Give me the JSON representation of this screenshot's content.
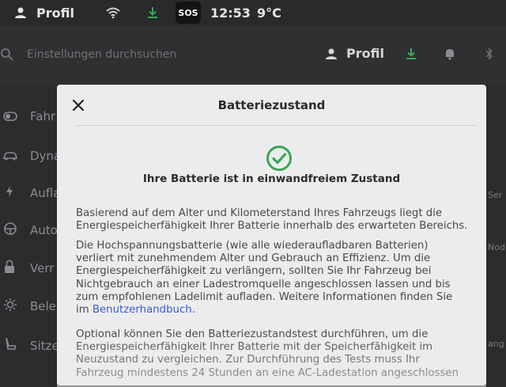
{
  "status_bar": {
    "profile_label": "Profil",
    "time": "12:53",
    "temperature": "9°C",
    "sos_label": "SOS"
  },
  "settings_header": {
    "search_placeholder": "Einstellungen durchsuchen",
    "profile_label": "Profil"
  },
  "sidebar": {
    "items": [
      {
        "label": "Fahr",
        "icon": "toggle-icon"
      },
      {
        "label": "Dyna",
        "icon": "car-icon"
      },
      {
        "label": "Aufla",
        "icon": "bolt-icon"
      },
      {
        "label": "Auto",
        "icon": "steering-wheel-icon"
      },
      {
        "label": "Verr",
        "icon": "lock-icon"
      },
      {
        "label": "Bele",
        "icon": "sun-icon"
      },
      {
        "label": "Sitze",
        "icon": "seat-icon"
      }
    ]
  },
  "right_fragments": [
    "Ser",
    "Nod",
    "ang"
  ],
  "modal": {
    "title": "Batteriezustand",
    "status": "Ihre Batterie ist in einwandfreiem Zustand",
    "paragraph1": "Basierend auf dem Alter und Kilometerstand Ihres Fahrzeugs liegt die Energiespeicherfähigkeit Ihrer Batterie innerhalb des erwarteten Bereichs.",
    "paragraph2": "Die Hochspannungsbatterie (wie alle wiederaufladbaren Batterien) verliert mit zunehmendem Alter und Gebrauch an Effizienz. Um die Energiespeicherfähigkeit zu verlängern, sollten Sie Ihr Fahrzeug bei Nichtgebrauch an einer Ladestromquelle angeschlossen lassen und bis zum empfohlenen Ladelimit aufladen. Weitere Informationen finden Sie im ",
    "manual_link": "Benutzerhandbuch",
    "paragraph2_end": ".",
    "paragraph3": "Optional können Sie den Batteriezustandstest durchführen, um die Energiespeicherfähigkeit Ihrer Batterie mit der Speicherfähigkeit im Neuzustand zu vergleichen. Zur Durchführung des Tests muss Ihr Fahrzeug mindestens 24 Stunden an eine AC-Ladestation angeschlossen",
    "check_color": "#3aa657"
  }
}
